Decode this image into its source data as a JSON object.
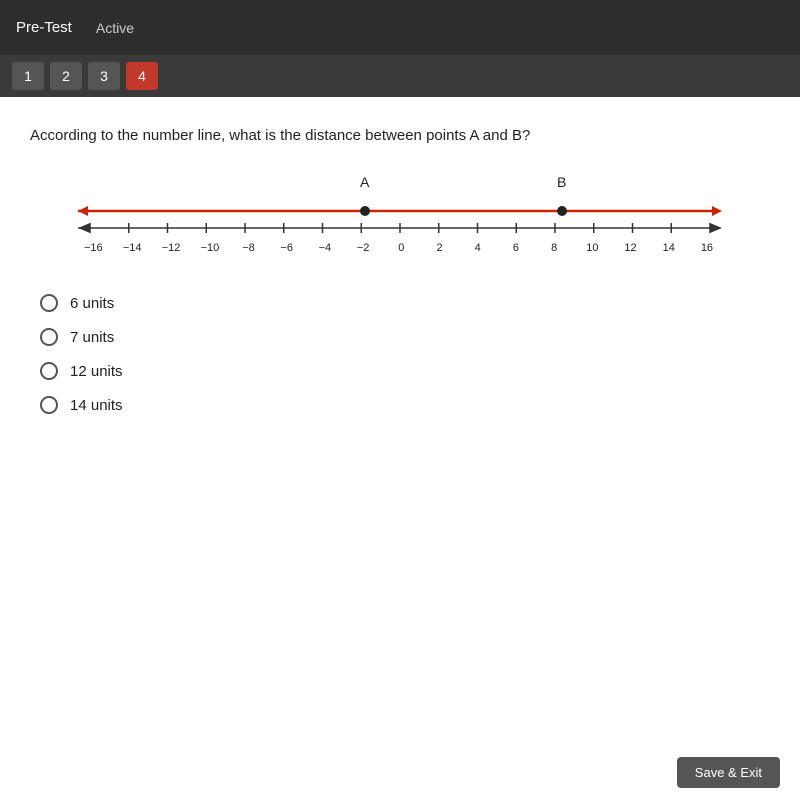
{
  "header": {
    "title": "Pre-Test",
    "status": "Active"
  },
  "tabs": [
    {
      "label": "1",
      "active": false
    },
    {
      "label": "2",
      "active": false
    },
    {
      "label": "3",
      "active": false
    },
    {
      "label": "4",
      "active": true
    }
  ],
  "question": {
    "text": "According to the number line, what is the distance between points A and B?"
  },
  "number_line": {
    "point_a_label": "A",
    "point_b_label": "B",
    "numbers": [
      "-16",
      "-14",
      "-12",
      "-10",
      "-8",
      "-6",
      "-4",
      "-2",
      "0",
      "2",
      "4",
      "6",
      "8",
      "10",
      "12",
      "14",
      "16"
    ]
  },
  "choices": [
    {
      "id": "a",
      "label": "6 units"
    },
    {
      "id": "b",
      "label": "7 units"
    },
    {
      "id": "c",
      "label": "12 units"
    },
    {
      "id": "d",
      "label": "14 units"
    }
  ],
  "buttons": {
    "save_exit": "Save & Exit"
  },
  "colors": {
    "active_tab": "#c0392b",
    "header_bg": "#2d2d2d",
    "red_line": "#cc2200"
  }
}
